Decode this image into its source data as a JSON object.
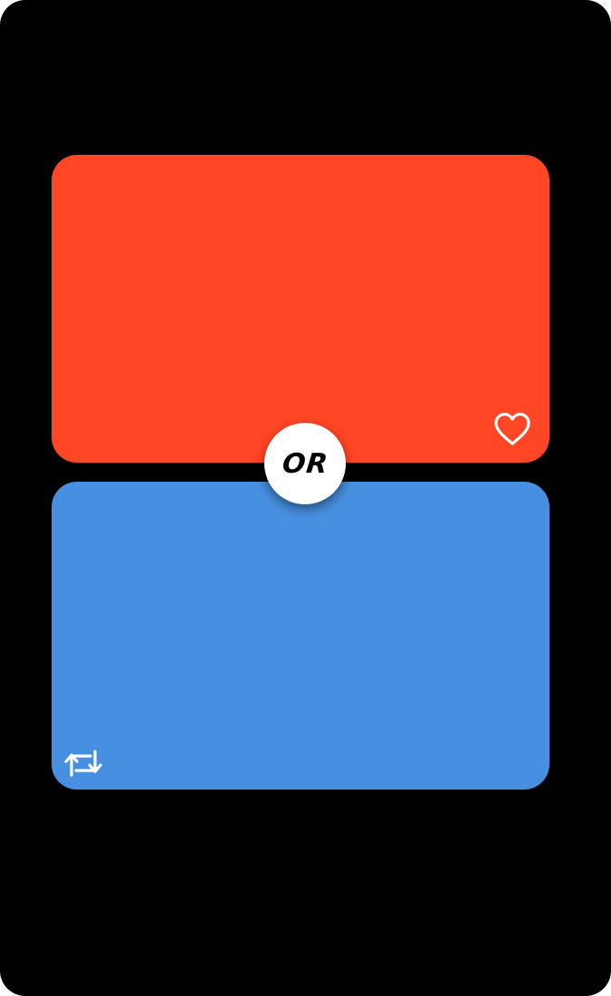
{
  "options": {
    "top": {
      "color": "#FF4625",
      "icon": "heart-outline-icon"
    },
    "bottom": {
      "color": "#4790E1",
      "icon": "repeat-icon"
    }
  },
  "divider": {
    "label": "OR"
  },
  "colors": {
    "background": "#000000",
    "badge": "#FFFFFF",
    "icon": "#FFFFFF"
  }
}
